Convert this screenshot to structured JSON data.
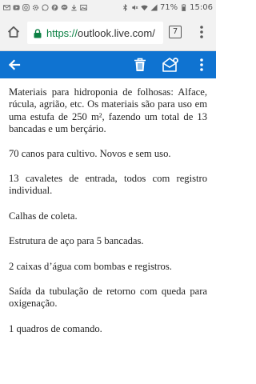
{
  "status_bar": {
    "battery": "71%",
    "time": "15:06"
  },
  "browser": {
    "url_scheme": "https://",
    "url_host": "outlook.live.com/",
    "tab_count": "7"
  },
  "colors": {
    "app_bar": "#0f73d1",
    "url_secure": "#0b8043"
  },
  "message": {
    "paragraphs": [
      "Materiais para hidroponia de folhosas: Alface, rúcula, agrião, etc. Os materiais são para uso em uma estufa de 250 m², fazendo um total de 13 bancadas e um berçário.",
      "70 canos para cultivo. Novos e sem uso.",
      "13 cavaletes de entrada, todos com registro individual.",
      "Calhas de coleta.",
      "Estrutura de aço para 5 bancadas.",
      "2 caixas d’água com bombas e registros.",
      "Saída da tubulação de retorno com queda para oxigenação.",
      "1 quadros de comando."
    ]
  }
}
